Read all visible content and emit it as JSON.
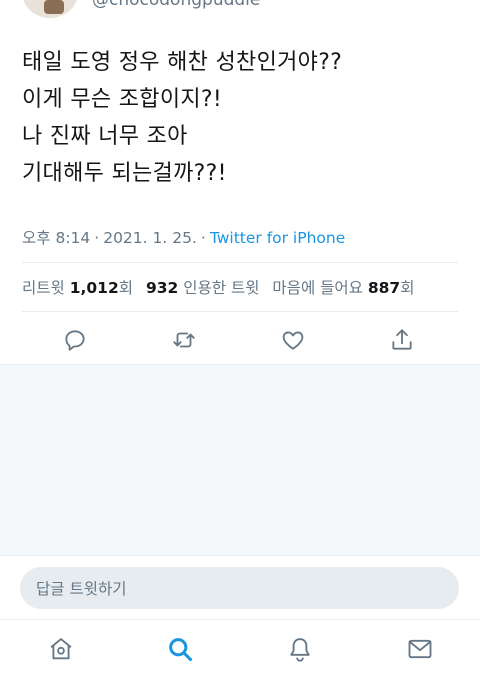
{
  "author": {
    "handle": "@chocodongpuddle",
    "avatar_icon": "avatar-image"
  },
  "tweet": {
    "lines": [
      "태일 도영 정우 해찬 성찬인거야??",
      "이게 무슨 조합이지?!",
      "나 진짜 너무 조아",
      "기대해두 되는걸까??!"
    ],
    "time": "오후 8:14",
    "date": "2021. 1. 25.",
    "source": "Twitter for iPhone"
  },
  "stats": {
    "retweets_label": "리트윗",
    "retweets_value": "1,012",
    "retweets_unit": "회",
    "quotes_value": "932",
    "quotes_label": "인용한 트윗",
    "likes_label": "마음에 들어요",
    "likes_value": "887",
    "likes_unit": "회"
  },
  "actions": [
    "reply-icon",
    "retweet-icon",
    "like-icon",
    "share-icon"
  ],
  "reply": {
    "placeholder": "답글 트윗하기"
  },
  "tabbar": [
    "home-icon",
    "search-icon",
    "notifications-icon",
    "messages-icon"
  ],
  "colors": {
    "accent": "#1b95e0",
    "secondary_text": "#657786",
    "divider": "#e6ecf0",
    "background_gray": "#f5f8fa"
  }
}
